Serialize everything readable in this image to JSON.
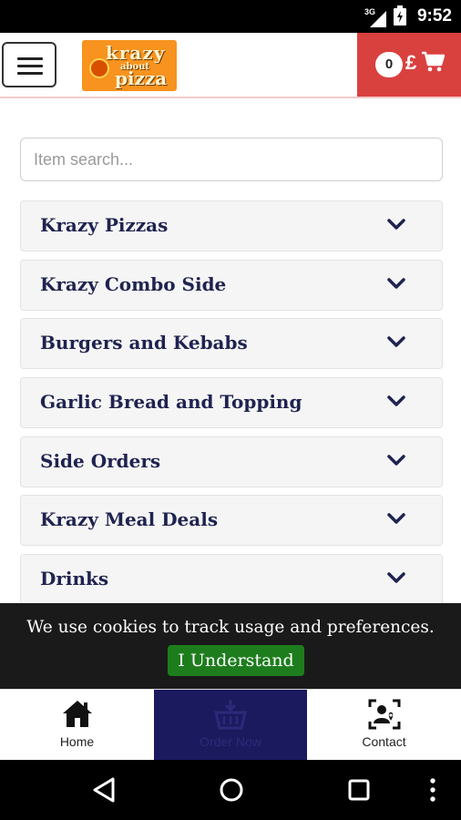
{
  "status_bar": {
    "time": "9:52",
    "network_label": "3G",
    "icons": [
      "signal-icon",
      "battery-icon"
    ]
  },
  "header": {
    "logo_text": [
      "krazy",
      "about",
      "pizza"
    ],
    "cart_count": "0",
    "cart_currency": "£",
    "cart_color": "#d9413f"
  },
  "search": {
    "placeholder": "Item search..."
  },
  "categories": [
    {
      "label": "Krazy Pizzas"
    },
    {
      "label": "Krazy Combo Side"
    },
    {
      "label": "Burgers and Kebabs"
    },
    {
      "label": "Garlic Bread and Topping"
    },
    {
      "label": "Side Orders"
    },
    {
      "label": "Krazy Meal Deals"
    },
    {
      "label": "Drinks"
    }
  ],
  "cookie_banner": {
    "text": "We use cookies to track usage and preferences.",
    "button_label": "I Understand",
    "button_color": "#1d7d1d"
  },
  "bottom_nav": {
    "items": [
      {
        "label": "Home",
        "icon": "home-icon"
      },
      {
        "label": "Order Now",
        "icon": "basket-icon"
      },
      {
        "label": "Contact",
        "icon": "contact-icon"
      }
    ],
    "active_color": "#1c1a5e"
  },
  "android_nav": {
    "icons": [
      "back-icon",
      "home-circle-icon",
      "recents-icon",
      "overflow-menu-icon"
    ]
  },
  "colors": {
    "text_dark_navy": "#1f2350",
    "accent_red": "#d9413f",
    "logo_orange": "#f7931e"
  }
}
